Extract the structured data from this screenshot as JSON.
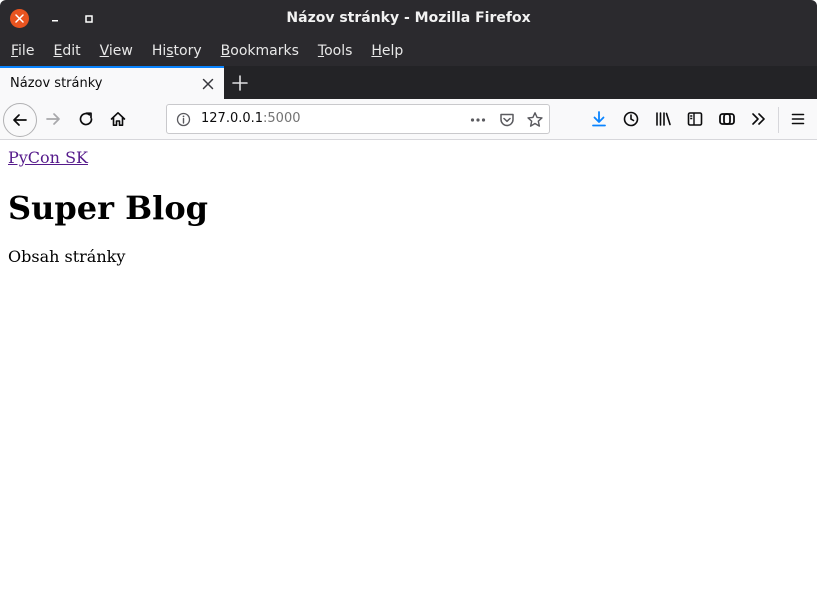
{
  "window": {
    "title": "Názov stránky - Mozilla Firefox",
    "close_color": "#e95420"
  },
  "menu": {
    "items": [
      {
        "label": "File",
        "accel": "F",
        "rest": "ile"
      },
      {
        "label": "Edit",
        "accel": "E",
        "rest": "dit"
      },
      {
        "label": "View",
        "accel": "V",
        "rest": "iew"
      },
      {
        "label": "History",
        "pre": "Hi",
        "accel": "s",
        "rest": "tory"
      },
      {
        "label": "Bookmarks",
        "accel": "B",
        "rest": "ookmarks"
      },
      {
        "label": "Tools",
        "accel": "T",
        "rest": "ools"
      },
      {
        "label": "Help",
        "accel": "H",
        "rest": "elp"
      }
    ]
  },
  "tab": {
    "title": "Názov stránky",
    "accent": "#0a84ff"
  },
  "toolbar": {
    "icons": [
      "back-icon",
      "forward-icon",
      "reload-icon",
      "home-icon",
      "download-icon",
      "history-icon",
      "library-icon",
      "sidebar-icon",
      "sync-icon",
      "overflow-icon",
      "menu-icon"
    ],
    "download_color": "#0a84ff"
  },
  "urlbar": {
    "host": "127.0.0.1",
    "port": ":5000"
  },
  "page": {
    "link": "PyCon SK",
    "link_color": "#551a8b",
    "heading": "Super Blog",
    "text": "Obsah stránky"
  }
}
